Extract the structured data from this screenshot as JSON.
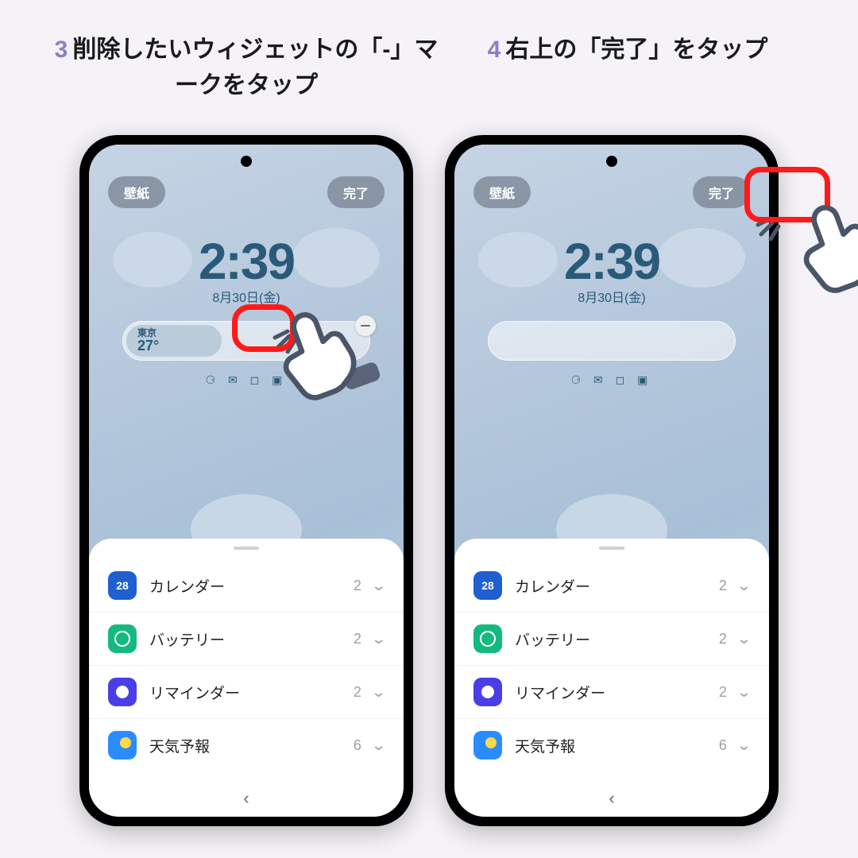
{
  "captions": {
    "step3": {
      "num": "3",
      "text": "削除したいウィジェットの「-」マークをタップ"
    },
    "step4": {
      "num": "4",
      "text": "右上の「完了」をタップ"
    }
  },
  "topbar": {
    "wallpaper": "壁紙",
    "done": "完了"
  },
  "clock": {
    "time": "2:39",
    "date": "8月30日(金)"
  },
  "weather": {
    "city": "東京",
    "temp": "27°"
  },
  "icon_row": "⚆ ✉ ◻ ▣",
  "widgets_panel": {
    "items": [
      {
        "icon": "cal",
        "icon_text": "28",
        "label": "カレンダー",
        "count": "2"
      },
      {
        "icon": "bat",
        "label": "バッテリー",
        "count": "2"
      },
      {
        "icon": "rem",
        "label": "リマインダー",
        "count": "2"
      },
      {
        "icon": "wea",
        "label": "天気予報",
        "count": "6"
      }
    ]
  },
  "nav": {
    "back": "‹"
  }
}
